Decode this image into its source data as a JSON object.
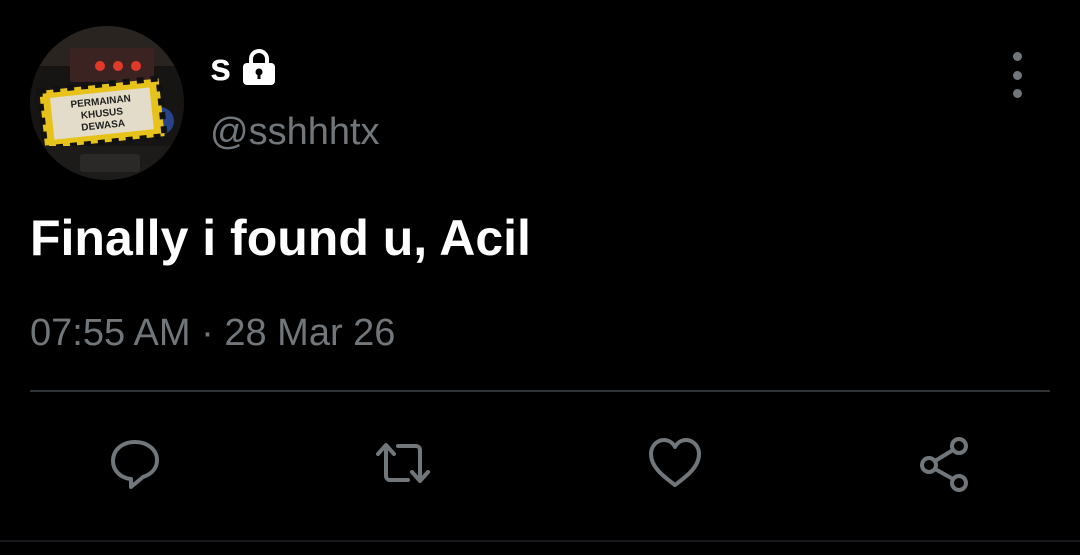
{
  "user": {
    "display_name": "s",
    "handle": "@sshhhtx",
    "avatar_sign_lines": [
      "PERMAINAN",
      "KHUSUS",
      "DEWASA"
    ]
  },
  "tweet": {
    "text": "Finally i found u, Acil",
    "time": "07:55 AM",
    "separator": "·",
    "date": "28 Mar 26"
  },
  "icons": {
    "protected": "lock-icon",
    "more": "more-vertical-icon",
    "reply": "reply-icon",
    "retweet": "retweet-icon",
    "like": "heart-icon",
    "share": "share-icon"
  },
  "colors": {
    "background": "#000000",
    "primary_text": "#ffffff",
    "secondary_text": "#71767b",
    "divider": "#2f3336"
  }
}
